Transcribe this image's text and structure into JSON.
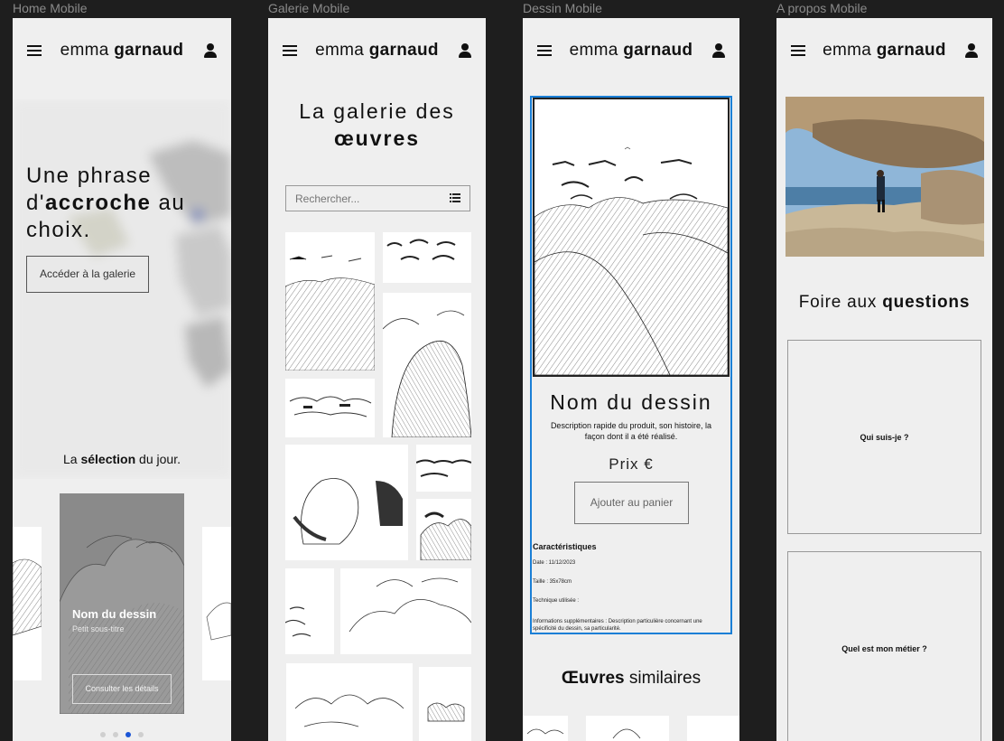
{
  "frames": {
    "home": "Home Mobile",
    "gallery": "Galerie Mobile",
    "drawing": "Dessin Mobile",
    "about": "A propos Mobile"
  },
  "brand": {
    "first": "emma",
    "last": "garnaud"
  },
  "home": {
    "hero_a": "Une phrase",
    "hero_b": "d'",
    "hero_c": "accroche",
    "hero_d": " au",
    "hero_e": "choix.",
    "cta": "Accéder à la galerie",
    "sel_a": "La ",
    "sel_b": "sélection",
    "sel_c": " du jour.",
    "card_title": "Nom du dessin",
    "card_sub": "Petit sous-titre",
    "card_btn": "Consulter les détails",
    "carousel_active": 3,
    "carousel_count": 4
  },
  "gallery": {
    "title_a": "La galerie des",
    "title_b": "œuvres",
    "search_placeholder": "Rechercher..."
  },
  "drawing": {
    "name": "Nom du dessin",
    "desc": "Description rapide du produit, son histoire, la façon dont il a été réalisé.",
    "price": "Prix €",
    "add": "Ajouter au panier",
    "specs_title": "Caractéristiques",
    "date": "Date : 11/12/2023",
    "size": "Taille : 35x78cm",
    "technique": "Technique utilisée :",
    "info": "Informations supplémentaires : Description particulière concernant une spécificité du dessin, sa particularité.",
    "similar_a": "Œuvres",
    "similar_b": " similaires"
  },
  "about": {
    "faq_a": "Foire aux ",
    "faq_b": "questions",
    "q1": "Qui suis-je ?",
    "q2": "Quel est mon métier ?"
  },
  "colors": {
    "selection": "#1a7fd6",
    "frame_bg": "#efefef",
    "canvas": "#1e1e1e"
  }
}
